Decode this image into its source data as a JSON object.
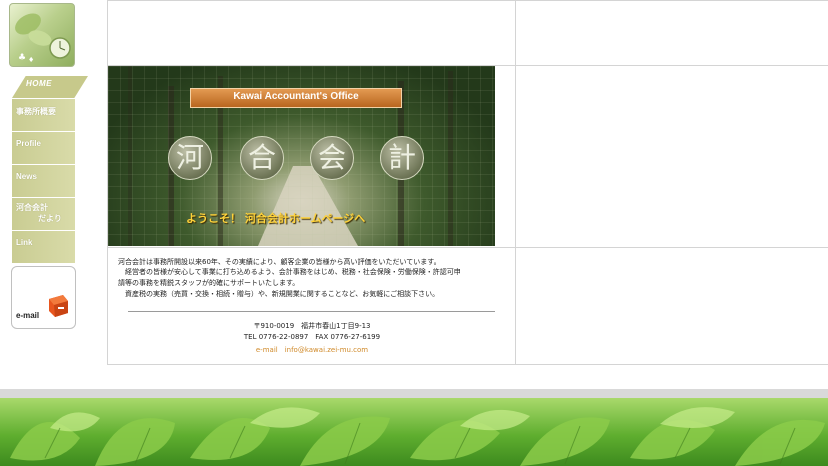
{
  "sidebar": {
    "home_label": "HOME",
    "items": [
      {
        "label": "事務所概要"
      },
      {
        "label": "Profile"
      },
      {
        "label": "News"
      },
      {
        "label": "河合会計",
        "sub": "だより"
      },
      {
        "label": "Link"
      }
    ],
    "email_label": "e-mail"
  },
  "banner": {
    "title": "Kawai Accountant's Office",
    "kanji": [
      "河",
      "合",
      "会",
      "計"
    ],
    "welcome": "ようこそ！ 河合会計ホームページへ"
  },
  "intro": {
    "lines": [
      "河合会計は事務所開設以来60年、その実績により、顧客企業の皆様から高い評価をいただいています。",
      "　経営者の皆様が安心して事業に打ち込めるよう、会計事務をはじめ、税務・社会保険・労働保険・許認可申",
      "請等の事務を精鋭スタッフが的確にサポートいたします。",
      "　資産税の実務（売買・交換・相続・贈与）や、新規開業に関することなど、お気軽にご相談下さい。"
    ]
  },
  "contact": {
    "address": "〒910-0019　福井市春山1丁目9-13",
    "phone": "TEL 0776-22-0897　FAX 0776-27-6199",
    "email": "e-mail　info@kawai.zei-mu.com"
  },
  "colors": {
    "sidebar_green": "#c9cc92",
    "title_orange": "#d07a30",
    "welcome_yellow": "#ffd23a",
    "email_orange": "#d08a2a"
  }
}
